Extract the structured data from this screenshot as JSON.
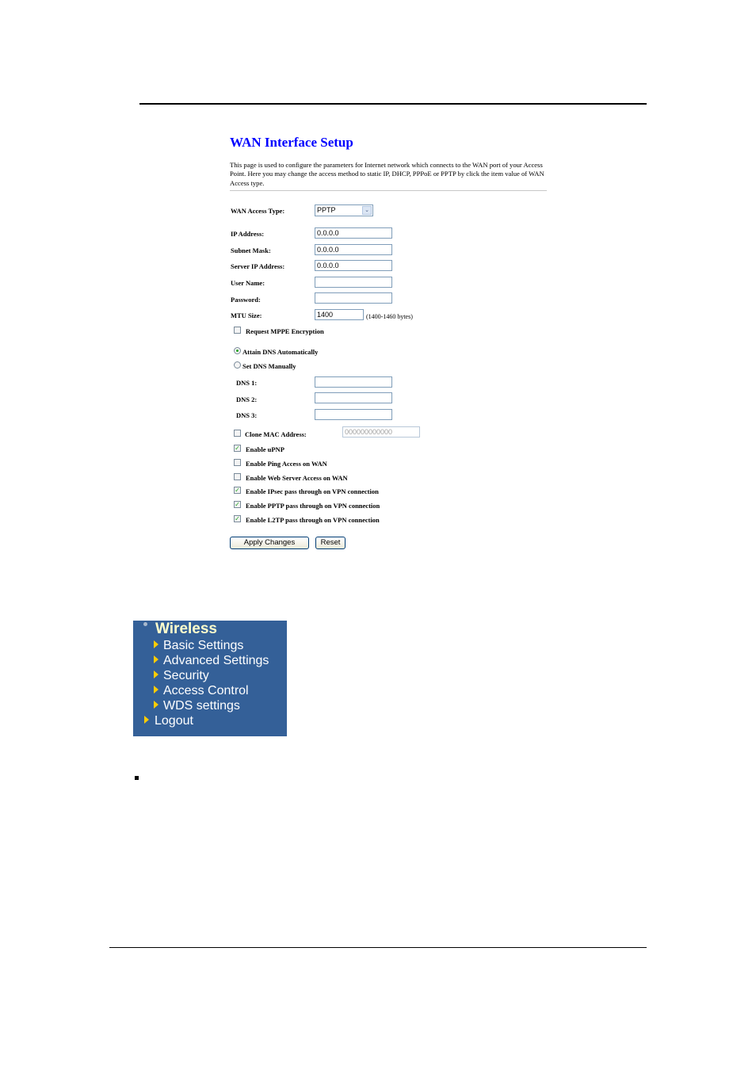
{
  "page": {
    "title": "WAN Interface Setup",
    "description": "This page is used to configure the parameters for Internet network which connects to the WAN port of your Access Point. Here you may change the access method to static IP, DHCP, PPPoE or PPTP by click the item value of WAN Access type."
  },
  "form": {
    "wan_access_type": {
      "label": "WAN Access Type:",
      "value": "PPTP"
    },
    "ip_address": {
      "label": "IP Address:",
      "value": "0.0.0.0"
    },
    "subnet_mask": {
      "label": "Subnet Mask:",
      "value": "0.0.0.0"
    },
    "server_ip": {
      "label": "Server IP Address:",
      "value": "0.0.0.0"
    },
    "user_name": {
      "label": "User Name:",
      "value": ""
    },
    "password": {
      "label": "Password:",
      "value": ""
    },
    "mtu": {
      "label": "MTU Size:",
      "value": "1400",
      "hint": "(1400-1460 bytes)"
    },
    "mppe": {
      "label": "Request MPPE Encryption",
      "checked": false
    },
    "dns_auto": {
      "label": "Attain DNS Automatically",
      "selected": true
    },
    "dns_manual": {
      "label": "Set DNS Manually",
      "selected": false
    },
    "dns1": {
      "label": "DNS 1:",
      "value": ""
    },
    "dns2": {
      "label": "DNS 2:",
      "value": ""
    },
    "dns3": {
      "label": "DNS 3:",
      "value": ""
    },
    "clone_mac": {
      "label": "Clone MAC Address:",
      "checked": false,
      "value": "000000000000"
    },
    "options": [
      {
        "label": "Enable uPNP",
        "checked": true
      },
      {
        "label": "Enable Ping Access on WAN",
        "checked": false
      },
      {
        "label": "Enable Web Server Access on WAN",
        "checked": false
      },
      {
        "label": "Enable IPsec pass through on VPN connection",
        "checked": true
      },
      {
        "label": "Enable PPTP pass through on VPN connection",
        "checked": true
      },
      {
        "label": "Enable L2TP pass through on VPN connection",
        "checked": true
      }
    ],
    "apply_label": "Apply Changes",
    "reset_label": "Reset"
  },
  "menu": {
    "heading": "Wireless",
    "items": [
      {
        "label": "Basic Settings"
      },
      {
        "label": "Advanced Settings"
      },
      {
        "label": "Security"
      },
      {
        "label": "Access Control"
      },
      {
        "label": "WDS settings"
      }
    ],
    "logout_label": "Logout"
  },
  "icons": {
    "check": "✓",
    "select_arrow": "⌄"
  },
  "colors": {
    "title": "#0000ff",
    "menu_bg": "#346098",
    "menu_heading": "#ffffcc",
    "menu_arrow": "#ffcc00",
    "check": "#21a121"
  }
}
